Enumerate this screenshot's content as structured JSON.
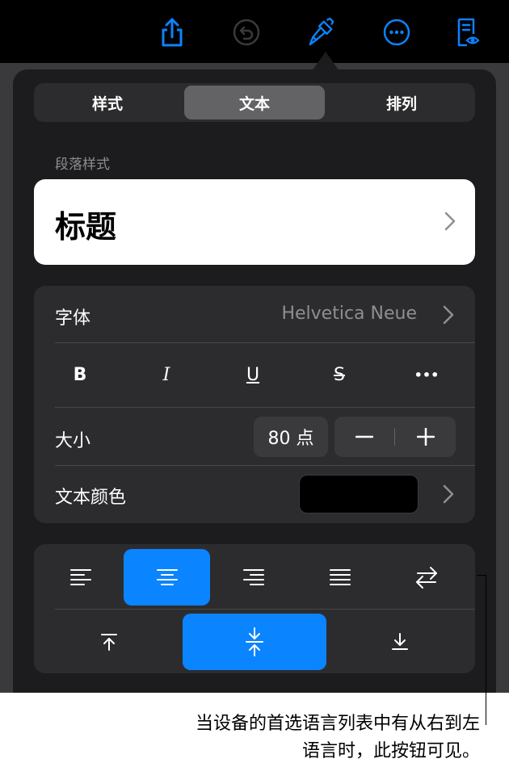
{
  "toolbar": {
    "icons": [
      "share-icon",
      "undo-icon",
      "format-brush-icon",
      "more-icon",
      "document-view-icon"
    ],
    "accent": "#0a84ff"
  },
  "tabs": [
    {
      "label": "样式",
      "active": false
    },
    {
      "label": "文本",
      "active": true
    },
    {
      "label": "排列",
      "active": false
    }
  ],
  "paragraph_style": {
    "section_label": "段落样式",
    "value": "标题"
  },
  "font": {
    "label": "字体",
    "value": "Helvetica Neue"
  },
  "formatting": {
    "bold": "B",
    "italic": "I",
    "underline": "U",
    "strikethrough": "S",
    "more": "•••"
  },
  "size": {
    "label": "大小",
    "value": "80 点",
    "decrement": "−",
    "increment": "+"
  },
  "text_color": {
    "label": "文本颜色",
    "color": "#000000"
  },
  "alignment": {
    "horizontal_selected": "center",
    "vertical_selected": "middle"
  },
  "callout": {
    "line1": "当设备的首选语言列表中有从右到左",
    "line2": "语言时，此按钮可见。"
  }
}
